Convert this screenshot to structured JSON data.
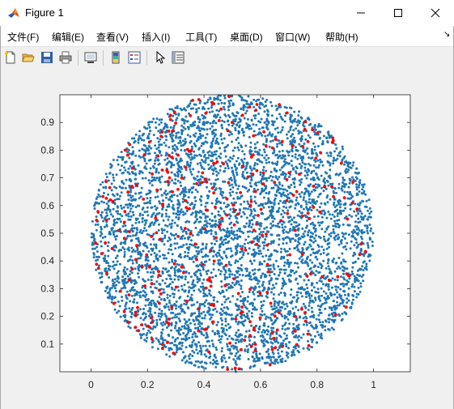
{
  "window": {
    "title": "Figure 1",
    "app_icon": "matlab-icon",
    "controls": [
      "minimize-icon",
      "maximize-icon",
      "close-icon"
    ]
  },
  "menu": {
    "items": [
      {
        "label": "文件(F)"
      },
      {
        "label": "编辑(E)"
      },
      {
        "label": "查看(V)"
      },
      {
        "label": "插入(I)"
      },
      {
        "label": "工具(T)"
      },
      {
        "label": "桌面(D)"
      },
      {
        "label": "窗口(W)"
      },
      {
        "label": "帮助(H)"
      }
    ],
    "overflow_icon": "dock-arrow-icon"
  },
  "toolbar": {
    "buttons": [
      "new-figure-icon",
      "open-file-icon",
      "save-icon",
      "print-icon",
      "link-plot-icon",
      "insert-colorbar-icon",
      "insert-legend-icon",
      "edit-plot-arrow-icon",
      "property-inspector-icon"
    ]
  },
  "colors": {
    "population": "#1f77b4",
    "selected": "#ff0000",
    "figure_bg": "#f0f0f0",
    "axes_bg": "#ffffff"
  },
  "chart_data": {
    "type": "scatter",
    "title": "",
    "xlabel": "",
    "ylabel": "",
    "xlim": [
      -0.11,
      1.13
    ],
    "ylim": [
      0.0,
      1.0
    ],
    "xticks": [
      0,
      0.2,
      0.4,
      0.6,
      0.8,
      1
    ],
    "yticks": [
      0.1,
      0.2,
      0.3,
      0.4,
      0.5,
      0.6,
      0.7,
      0.8,
      0.9
    ],
    "grid": false,
    "legend": "none",
    "region": {
      "shape": "disk",
      "center": [
        0.5,
        0.5
      ],
      "radius": 0.5
    },
    "series": [
      {
        "color": "#1f77b4",
        "marker": "dot",
        "count": 5000,
        "distribution": "uniform in disk"
      },
      {
        "color": "#ff0000",
        "marker": "dot",
        "count": 300,
        "distribution": "uniform in disk"
      }
    ]
  }
}
